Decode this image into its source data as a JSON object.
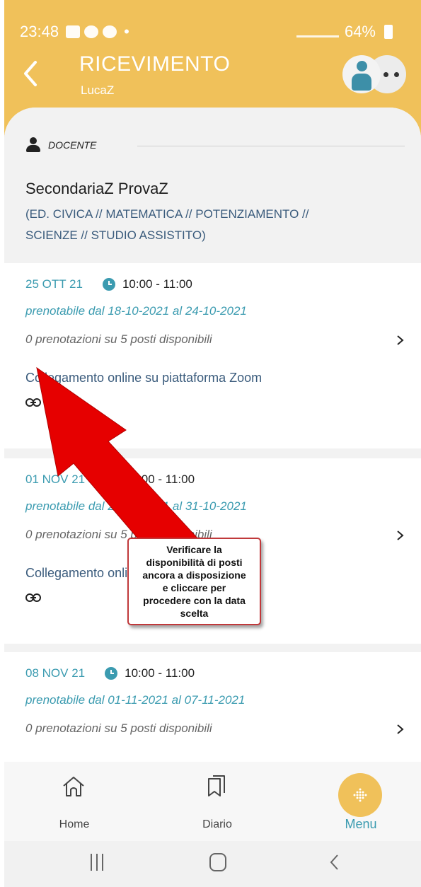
{
  "status_bar": {
    "time": "23:48",
    "dot": "•",
    "battery": "64%"
  },
  "header": {
    "title": "RICEVIMENTO",
    "subtitle": "LucaZ",
    "back_icon": "chevron-left-icon",
    "avatar_icon": "user-icon",
    "more_icon": "more-dots-icon"
  },
  "teacher": {
    "role": "DOCENTE",
    "name": "SecondariaZ ProvaZ",
    "subjects_line1": "(ED. CIVICA // MATEMATICA // POTENZIAMENTO //",
    "subjects_line2": "SCIENZE // STUDIO ASSISTITO)"
  },
  "slots": [
    {
      "date": "25 OTT 21",
      "time": "10:00 - 11:00",
      "range": "prenotabile dal 18-10-2021 al 24-10-2021",
      "seats": "0 prenotazioni su 5 posti disponibili",
      "description": "Collegamento online su piattaforma Zoom"
    },
    {
      "date": "01 NOV 21",
      "time": "10:00 - 11:00",
      "range": "prenotabile dal 25-10-2021 al 31-10-2021",
      "seats": "0 prenotazioni su 5 posti disponibili",
      "description": "Collegamento online su piattaforma Zoom"
    },
    {
      "date": "08 NOV 21",
      "time": "10:00 - 11:00",
      "range": "prenotabile dal 01-11-2021 al 07-11-2021",
      "seats": "0 prenotazioni su 5 posti disponibili",
      "description": ""
    }
  ],
  "bottom_nav": {
    "home": "Home",
    "diario": "Diario",
    "menu": "Menu"
  },
  "annotation": {
    "line1": "Verificare la",
    "line2": "disponibilità di posti",
    "line3": "ancora a disposizione",
    "line4": "e cliccare per",
    "line5": "procedere con la data",
    "line6": "scelta"
  },
  "colors": {
    "header": "#f0c15a",
    "accent": "#3b9bb0",
    "text_blue": "#3a5b7c",
    "arrow": "#e60000"
  }
}
